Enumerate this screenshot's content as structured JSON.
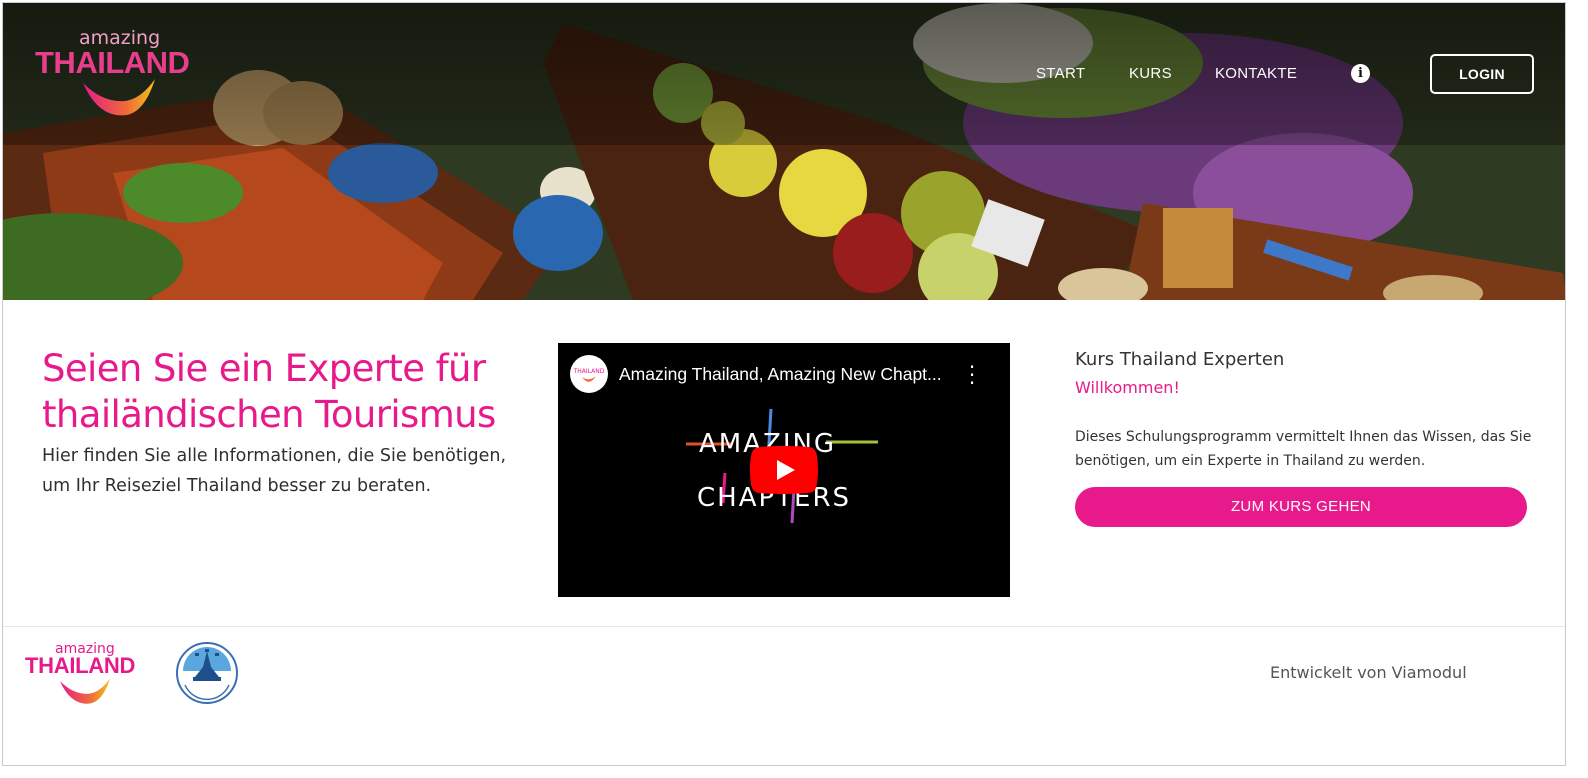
{
  "brand": {
    "logo_small": "amazing",
    "logo_big": "THAILAND",
    "accent_color": "#e8198b"
  },
  "nav": {
    "items": [
      "START",
      "KURS",
      "KONTAKTE"
    ],
    "info_icon": "info-icon",
    "login_label": "LOGIN"
  },
  "hero": {
    "image_alt": "floating market boats"
  },
  "main": {
    "headline": "Seien Sie ein Experte für thailändischen Tourismus",
    "intro": "Hier finden Sie alle Informationen, die Sie benötigen, um Ihr Reiseziel Thailand besser zu beraten."
  },
  "video": {
    "title": "Amazing Thailand, Amazing New Chapt...",
    "wordmark_line1": "AMAZING",
    "wordmark_line2": "CHAPTERS",
    "channel_logo_text": "THAILAND"
  },
  "course": {
    "title": "Kurs Thailand Experten",
    "welcome": "Willkommen!",
    "description": "Dieses Schulungsprogramm vermittelt Ihnen das Wissen, das Sie benötigen, um ein Experte in Thailand zu werden.",
    "button_label": "ZUM KURS GEHEN"
  },
  "footer": {
    "logo_small": "amazing",
    "logo_big": "THAILAND",
    "tat_logo_text": "TOURISM AUTHORITY OF THAILAND",
    "developer": "Entwickelt von Viamodul"
  }
}
